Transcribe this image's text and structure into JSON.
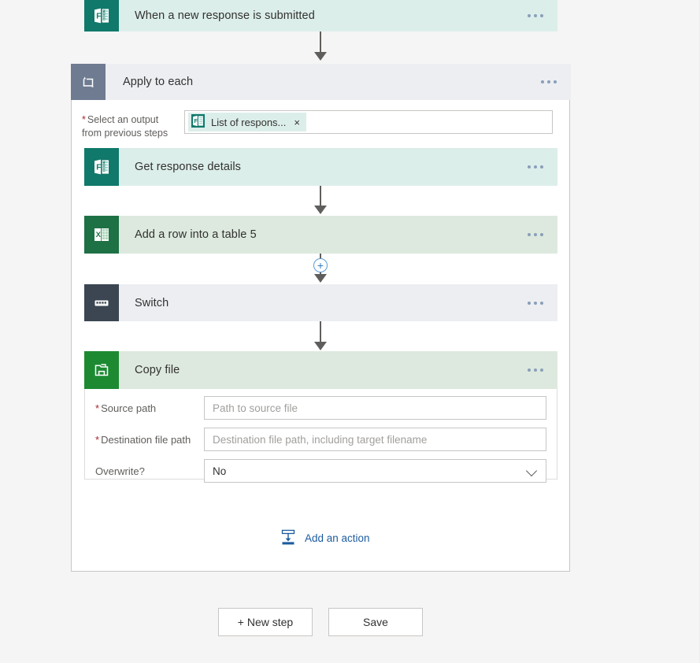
{
  "flow": {
    "trigger": {
      "title": "When a new response is submitted",
      "icon": "microsoft-forms-icon",
      "overflow_label": "..."
    },
    "loop": {
      "title": "Apply to each",
      "icon": "apply-to-each-loop-icon",
      "input_label_line1": "Select an output",
      "input_label_line2": "from previous steps",
      "required_marker": "*",
      "token": {
        "text": "List of respons...",
        "icon": "microsoft-forms-icon",
        "remove_label": "×"
      },
      "actions": [
        {
          "title": "Get response details",
          "icon": "microsoft-forms-icon",
          "card_color": "#dceeea",
          "icon_color": "#10796b"
        },
        {
          "title": "Add a row into a table 5",
          "icon": "microsoft-excel-icon",
          "card_color": "#dde9de",
          "icon_color": "#1e7145"
        },
        {
          "title": "Switch",
          "icon": "switch-control-icon",
          "card_color": "#eceef2",
          "icon_color": "#3b4652"
        }
      ],
      "copy_file": {
        "title": "Copy file",
        "icon": "copy-file-icon",
        "card_color": "#dde9de",
        "icon_color": "#1d8a32",
        "fields": [
          {
            "label": "Source path",
            "required": true,
            "placeholder": "Path to source file",
            "value": "",
            "type": "text"
          },
          {
            "label": "Destination file path",
            "required": true,
            "placeholder": "Destination file path, including target filename",
            "value": "",
            "type": "text"
          },
          {
            "label": "Overwrite?",
            "required": false,
            "placeholder": "",
            "value": "No",
            "type": "select"
          }
        ]
      },
      "add_action": {
        "label": "Add an action",
        "icon": "add-an-action-icon"
      }
    },
    "insert_badge_label": "+"
  },
  "footer": {
    "new_step_label": "+ New step",
    "save_label": "Save"
  },
  "colors": {
    "page_background": "#f5f5f5",
    "trigger_card": "#dceeea",
    "loop_header": "#eceef2",
    "excel_card": "#dde9de",
    "accent_link": "#1b5b9e",
    "required_asterisk": "#a4262c",
    "connector": "#605e5c",
    "plus_badge_border": "#5b9bd5"
  }
}
